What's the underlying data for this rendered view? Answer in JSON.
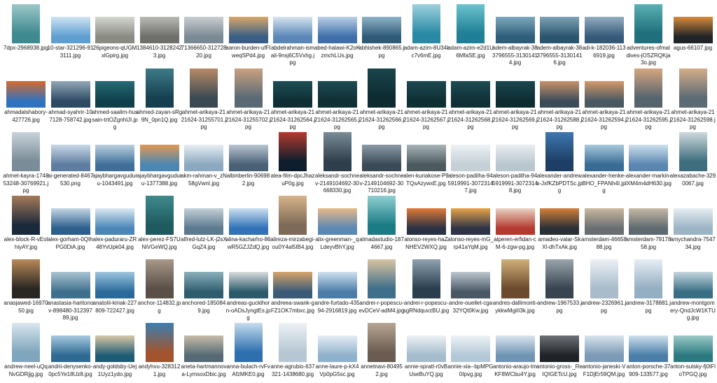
{
  "files": [
    {
      "name": "7dpx-2968938.jpg",
      "img": {
        "c": "#3f8a90",
        "c2": "#9cc8c9",
        "o": "p"
      }
    },
    {
      "name": "10-star-321296-913111.jpg",
      "img": {
        "c": "#5f9fd0",
        "c2": "#cfe4f3",
        "o": "l"
      }
    },
    {
      "name": "26pigeons-qUGMxlGpirg.jpg",
      "img": {
        "c": "#8a8c84",
        "c2": "#d4d6d0",
        "o": "l"
      }
    },
    {
      "name": "1384610-31282423.jpg",
      "img": {
        "c": "#6f6f6c",
        "c2": "#b9b9b4",
        "o": "l"
      }
    },
    {
      "name": "71366650-31272820.jpg",
      "img": {
        "c": "#7a8a93",
        "c2": "#c9ced1",
        "o": "l"
      }
    },
    {
      "name": "aaron-burden-ufFIweqSPd4.jpg",
      "img": {
        "c": "#3a5f86",
        "c2": "#d9a76a",
        "o": "l"
      }
    },
    {
      "name": "abdelrahman-ismail-9nsj6C5Vxhg.jpg",
      "img": {
        "c": "#5b87b8",
        "c2": "#d7e4ef",
        "o": "l"
      }
    },
    {
      "name": "abed-halawi-K2oKzmchLUs.jpg",
      "img": {
        "c": "#3e6fa9",
        "c2": "#bcd1e6",
        "o": "l"
      }
    },
    {
      "name": "abhishek-890865.jpg",
      "img": {
        "c": "#2f5a78",
        "c2": "#8fb3c7",
        "o": "l"
      }
    },
    {
      "name": "adam-azim-8U34Ic7v6mE.jpg",
      "img": {
        "c": "#2a8aa6",
        "c2": "#9ed1dd",
        "o": "p"
      }
    },
    {
      "name": "adam-azim-e2d1U6MfaSE.jpg",
      "img": {
        "c": "#1f7f96",
        "c2": "#6cc4cf",
        "o": "p"
      }
    },
    {
      "name": "adem-albayrak-383796555-31301414.jpg",
      "img": {
        "c": "#2e5e7a",
        "c2": "#7fa8be",
        "o": "l"
      }
    },
    {
      "name": "adem-albayrak-383796555-31301416.jpg",
      "img": {
        "c": "#2a556e",
        "c2": "#7ea2b6",
        "o": "l"
      }
    },
    {
      "name": "adi-k-182036-1136919.jpg",
      "img": {
        "c": "#355a78",
        "c2": "#93adc1",
        "o": "l"
      }
    },
    {
      "name": "adventures-ofmaldives-jOSZRQKja3o.jpg",
      "img": {
        "c": "#1f6f7c",
        "c2": "#5ab2b3",
        "o": "p"
      }
    },
    {
      "name": "agus-66107.jpg",
      "img": {
        "c": "#202428",
        "c2": "#d98a3a",
        "o": "l"
      }
    },
    {
      "name": "ahmadalshabory-427726.jpg",
      "img": {
        "c": "#2f72c0",
        "c2": "#d46a2e",
        "o": "l"
      }
    },
    {
      "name": "ahmad-syahrir-107128-758742.jpg",
      "img": {
        "c": "#2d4a63",
        "c2": "#93a8b8",
        "o": "l"
      }
    },
    {
      "name": "ahmed-saalim-hussain-trtOZgnhlJI.jpg",
      "img": {
        "c": "#0f3f4a",
        "c2": "#276a74",
        "o": "l"
      }
    },
    {
      "name": "ahmed-zayan-sRg9N_0pn1Q.jpg",
      "img": {
        "c": "#16404f",
        "c2": "#3f7b88",
        "o": "p"
      }
    },
    {
      "name": "ahmet-arikaya-2121624-31255701.jpg",
      "img": {
        "c": "#3b4a52",
        "c2": "#b88a66",
        "o": "p"
      }
    },
    {
      "name": "ahmet-arikaya-2121624-31255702.jpg",
      "img": {
        "c": "#5a6a74",
        "c2": "#c9a27f",
        "o": "p"
      }
    },
    {
      "name": "ahmet-arikaya-2121624-31262564.jpg",
      "img": {
        "c": "#0e2e33",
        "c2": "#1f4e56",
        "o": "l"
      }
    },
    {
      "name": "ahmet-arikaya-2121624-31262565.jpg",
      "img": {
        "c": "#0f3035",
        "c2": "#1d4a52",
        "o": "l"
      }
    },
    {
      "name": "ahmet-arikaya-2121624-31262566.jpg",
      "img": {
        "c": "#0d2b31",
        "c2": "#1b454c",
        "o": "p"
      }
    },
    {
      "name": "ahmet-arikaya-2121624-31262567.jpg",
      "img": {
        "c": "#0e2f34",
        "c2": "#1c4850",
        "o": "l"
      }
    },
    {
      "name": "ahmet-arikaya-2121624-31262568.jpg",
      "img": {
        "c": "#0f3036",
        "c2": "#1e4b53",
        "o": "l"
      }
    },
    {
      "name": "ahmet-arikaya-2121624-31262569.jpg",
      "img": {
        "c": "#0d2c32",
        "c2": "#1c474f",
        "o": "l"
      }
    },
    {
      "name": "ahmet-arikaya-2121624-31262588.jpg",
      "img": {
        "c": "#3c4c58",
        "c2": "#c7926a",
        "o": "l"
      }
    },
    {
      "name": "ahmet-arikaya-2121624-31262594.jpg",
      "img": {
        "c": "#4a5862",
        "c2": "#d39a6b",
        "o": "l"
      }
    },
    {
      "name": "ahmet-arikaya-2121624-31262595.jpg",
      "img": {
        "c": "#56646e",
        "c2": "#d6a77f",
        "o": "p"
      }
    },
    {
      "name": "ahmet-arikaya-2121624-31262598.jpg",
      "img": {
        "c": "#5d6b74",
        "c2": "#d4ad88",
        "o": "p"
      }
    },
    {
      "name": "ahmet-kayra-174853248-30769921.jpg",
      "img": {
        "c": "#7a8c98",
        "c2": "#c8d3da",
        "o": "p"
      }
    },
    {
      "name": "ai-generated-8467530.png",
      "img": {
        "c": "#5e7da0",
        "c2": "#c9d8e6",
        "o": "l"
      }
    },
    {
      "name": "ajaybhargavguduru-1043491.jpg",
      "img": {
        "c": "#3f6f98",
        "c2": "#bcd0df",
        "o": "l"
      }
    },
    {
      "name": "ajaybhargavguduru-1377388.jpg",
      "img": {
        "c": "#4a87b4",
        "c2": "#e09a52",
        "o": "l"
      }
    },
    {
      "name": "akm-rahman-v_zN58gVwnI.jpg",
      "img": {
        "c": "#8aa8c0",
        "c2": "#e8eef3",
        "o": "l"
      }
    },
    {
      "name": "albinberlin-906982.jpg",
      "img": {
        "c": "#4a6075",
        "c2": "#b9c6d1",
        "o": "l"
      }
    },
    {
      "name": "alea-film-dpcJhazuP0g.jpg",
      "img": {
        "c": "#0f1e2c",
        "c2": "#b43a2e",
        "o": "p"
      }
    },
    {
      "name": "aleksandr-sochnev-2149104692-30668330.jpg",
      "img": {
        "c": "#2f3f4c",
        "c2": "#7a8c98",
        "o": "p"
      }
    },
    {
      "name": "aleksandr-sochnev-2149104692-30710216.jpg",
      "img": {
        "c": "#3a4a56",
        "c2": "#8b9ba6",
        "o": "l"
      }
    },
    {
      "name": "alen-kuriakose-P9TQsAzywxE.jpg",
      "img": {
        "c": "#4c5a60",
        "c2": "#a9b4b8",
        "o": "l"
      }
    },
    {
      "name": "aleson-padilha-945919991-30723147.jpg",
      "img": {
        "c": "#c4cfd6",
        "c2": "#eef2f5",
        "o": "l"
      }
    },
    {
      "name": "aleson-padilha-945919991-30723148.jpg",
      "img": {
        "c": "#b9c6ce",
        "c2": "#e9eef2",
        "o": "l"
      }
    },
    {
      "name": "alexander-andrews-JxfKZbPDTSc.jpg",
      "img": {
        "c": "#1d3f66",
        "c2": "#3f77b0",
        "o": "p"
      }
    },
    {
      "name": "alexander-henke-BHO_FPANh4I.jpg",
      "img": {
        "c": "#386c95",
        "c2": "#a9c8dc",
        "o": "l"
      }
    },
    {
      "name": "alexander-markin-lXM4m4dH630.jpg",
      "img": {
        "c": "#5a86b0",
        "c2": "#cfe0ec",
        "o": "l"
      }
    },
    {
      "name": "alexazabache-3290067.jpg",
      "img": {
        "c": "#3d6e7e",
        "c2": "#cfd9dc",
        "o": "p"
      }
    },
    {
      "name": "alex-block-R-vEolhiyAY.jpg",
      "img": {
        "c": "#1b2a3a",
        "c2": "#a67a5a",
        "o": "p"
      }
    },
    {
      "name": "alex-gorham-0QIhPG0DiA.jpg",
      "img": {
        "c": "#2c5f8c",
        "c2": "#c5d8e6",
        "o": "l"
      }
    },
    {
      "name": "alex-paduraru-ZR48YvUpk04.jpg",
      "img": {
        "c": "#4a86b8",
        "c2": "#dbe8f2",
        "o": "l"
      }
    },
    {
      "name": "alex-perez-FS7UNiVGeWQ.jpg",
      "img": {
        "c": "#1e5a5e",
        "c2": "#3f8a8c",
        "o": "p"
      }
    },
    {
      "name": "alfred-lutz-LK-j2sXGqZ4.jpg",
      "img": {
        "c": "#5b7a8e",
        "c2": "#c3d0d8",
        "o": "l"
      }
    },
    {
      "name": "alina-kacharho-86wR5GZJZdQ.jpg",
      "img": {
        "c": "#3172b8",
        "c2": "#cde0f1",
        "o": "l"
      }
    },
    {
      "name": "alireza-mirzabegi-ou0Y4al5IB4.jpg",
      "img": {
        "c": "#7e6a58",
        "c2": "#d6b48a",
        "o": "p"
      }
    },
    {
      "name": "alix-greenman-_qLdeyvBhY.jpg",
      "img": {
        "c": "#5b88b2",
        "c2": "#e6b98a",
        "o": "l"
      }
    },
    {
      "name": "almadastudio-1874667.jpg",
      "img": {
        "c": "#1b7c86",
        "c2": "#8fd0d2",
        "o": "p"
      }
    },
    {
      "name": "alonso-reyes-haZNHEV2WXQ.jpg",
      "img": {
        "c": "#2a3142",
        "c2": "#e07a3a",
        "o": "l"
      }
    },
    {
      "name": "alonso-reyes-mG_rp41aYqM.jpg",
      "img": {
        "c": "#2e3446",
        "c2": "#e6a34a",
        "o": "l"
      }
    },
    {
      "name": "alperen-erfidan-cM-6-zgw-pg.jpg",
      "img": {
        "c": "#b33a2e",
        "c2": "#e9d4c4",
        "o": "l"
      }
    },
    {
      "name": "amadeo-valar-SkXl-dhTxAk.jpg",
      "img": {
        "c": "#2b2f36",
        "c2": "#d2803a",
        "o": "l"
      }
    },
    {
      "name": "amsterdam-4665888.jpg",
      "img": {
        "c": "#6a6e72",
        "c2": "#c9b8a0",
        "o": "l"
      }
    },
    {
      "name": "amsterdam-7917858.jpg",
      "img": {
        "c": "#5f6a70",
        "c2": "#c5b9a6",
        "o": "l"
      }
    },
    {
      "name": "amychandra-754734.jpg",
      "img": {
        "c": "#9bb4c4",
        "c2": "#e6edf2",
        "o": "l"
      }
    },
    {
      "name": "anasjawed-1697050.jpg",
      "img": {
        "c": "#2a2622",
        "c2": "#b88a5a",
        "o": "p"
      }
    },
    {
      "name": "anastasia-haritonov-898480-31239789.jpg",
      "img": {
        "c": "#3e6f8c",
        "c2": "#a9c3d2",
        "o": "l"
      }
    },
    {
      "name": "anatolii-kiriak-227809-722427.jpg",
      "img": {
        "c": "#2a6a9a",
        "c2": "#9cc5df",
        "o": "l"
      }
    },
    {
      "name": "anchor-114832.jpg",
      "img": {
        "c": "#5a5048",
        "c2": "#a89888",
        "o": "p"
      }
    },
    {
      "name": "anchored-1850849.jpg",
      "img": {
        "c": "#2f5d6e",
        "c2": "#8ab0bc",
        "o": "l"
      }
    },
    {
      "name": "andreas-gucklhorn-oADsJyngtEs.jpg",
      "img": {
        "c": "#2c5a6a",
        "c2": "#d8dcdc",
        "o": "l"
      }
    },
    {
      "name": "andreea-swank-gFZ1OK7mbxc.jpg",
      "img": {
        "c": "#3a5a78",
        "c2": "#d7a468",
        "o": "l"
      }
    },
    {
      "name": "andre-furtado-43594-2916819.jpg",
      "img": {
        "c": "#4c7da8",
        "c2": "#cfe0ee",
        "o": "l"
      }
    },
    {
      "name": "andrei-r-popescu-evDCeV-adM4.jpg",
      "img": {
        "c": "#3f6f8a",
        "c2": "#d9c4a2",
        "o": "p"
      }
    },
    {
      "name": "andrei-r-popescu-sgRNdquvzBU.jpg",
      "img": {
        "c": "#2b3e4e",
        "c2": "#8fa2b0",
        "o": "p"
      }
    },
    {
      "name": "andre-ouellet-cga32YQt0Kw.jpg",
      "img": {
        "c": "#4a5866",
        "c2": "#bcc6ce",
        "o": "l"
      }
    },
    {
      "name": "andres-dallimonti-ykkwMgiII3k.jpg",
      "img": {
        "c": "#6b4a2e",
        "c2": "#d2b07a",
        "o": "p"
      }
    },
    {
      "name": "andrew-1967533.jpg",
      "img": {
        "c": "#3a4450",
        "c2": "#9aa4ac",
        "o": "p"
      }
    },
    {
      "name": "andrew-2326961.jpg",
      "img": {
        "c": "#a8bccb",
        "c2": "#ecf1f5",
        "o": "p"
      }
    },
    {
      "name": "andrew-3178881.jpg",
      "img": {
        "c": "#94aec2",
        "c2": "#e6eef4",
        "o": "p"
      }
    },
    {
      "name": "andrew-montgomery-QndJcW1KTUg.jpg",
      "img": {
        "c": "#3a6e84",
        "c2": "#c3d6de",
        "o": "l"
      }
    },
    {
      "name": "andrew-neel-uQqNvGDRjjg.jpg",
      "img": {
        "c": "#7fa6bd",
        "c2": "#d9e6ee",
        "o": "p"
      }
    },
    {
      "name": "andrii-denysenko-0pc5Ye18Uz8.jpg",
      "img": {
        "c": "#2e6a92",
        "c2": "#a8c9df",
        "o": "l"
      }
    },
    {
      "name": "andy-goldsby-Uej1Uyz1ydo.jpg",
      "img": {
        "c": "#1f5c74",
        "c2": "#d8c8a6",
        "o": "l"
      }
    },
    {
      "name": "andyhvu-3283121.jpg",
      "img": {
        "c": "#a2542e",
        "c2": "#3a7fb0",
        "o": "p"
      }
    },
    {
      "name": "aneta-hartmannova-LymsoxDbic.jpg",
      "img": {
        "c": "#556a74",
        "c2": "#c8bca8",
        "o": "l"
      }
    },
    {
      "name": "anna-bulach-rvFvAfzMKE0.jpg",
      "img": {
        "c": "#2e6fae",
        "c2": "#c5dcee",
        "o": "p"
      }
    },
    {
      "name": "anne-agrubio-637321-1438680.jpg",
      "img": {
        "c": "#b6c7d3",
        "c2": "#eef2f5",
        "o": "p"
      }
    },
    {
      "name": "anne-laure-p-kX4Vp0pG5sc.jpg",
      "img": {
        "c": "#8fb2cc",
        "c2": "#e5eef4",
        "o": "l"
      }
    },
    {
      "name": "annetnavi-804952.jpg",
      "img": {
        "c": "#6a5c50",
        "c2": "#b8a694",
        "o": "p"
      }
    },
    {
      "name": "annie-spratt-r0vBUseBuYQ.jpg",
      "img": {
        "c": "#a4bccc",
        "c2": "#edf2f5",
        "o": "l"
      }
    },
    {
      "name": "annie-xia--bpMPG0Ipvg.jpg",
      "img": {
        "c": "#b3c8d6",
        "c2": "#eef3f6",
        "o": "l"
      }
    },
    {
      "name": "antonio-araujo-tmKF8WCbu4Y.jpg",
      "img": {
        "c": "#6f94b4",
        "c2": "#dbe6ee",
        "o": "l"
      }
    },
    {
      "name": "antonio-gross-_ReIQIGETcU.jpg",
      "img": {
        "c": "#1f2226",
        "c2": "#6e7278",
        "o": "l"
      }
    },
    {
      "name": "antonio-janeski-VF1DjEr59QM.jpg",
      "img": {
        "c": "#7b9ab4",
        "c2": "#d8e4ec",
        "o": "l"
      }
    },
    {
      "name": "anton-porsche-37909-133577.jpg",
      "img": {
        "c": "#4a7ea8",
        "c2": "#cfe0ec",
        "o": "l"
      }
    },
    {
      "name": "anton-sulsky-fj0tFloTPGQ.jpg",
      "img": {
        "c": "#2b7a80",
        "c2": "#9cc9c7",
        "o": "l"
      }
    }
  ]
}
